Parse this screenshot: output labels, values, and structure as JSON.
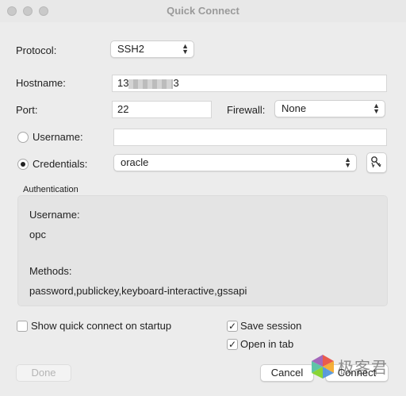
{
  "window": {
    "title": "Quick Connect"
  },
  "form": {
    "protocol_label": "Protocol:",
    "protocol_value": "SSH2",
    "hostname_label": "Hostname:",
    "hostname_prefix": "13",
    "hostname_suffix": "3",
    "port_label": "Port:",
    "port_value": "22",
    "firewall_label": "Firewall:",
    "firewall_value": "None",
    "username_label": "Username:",
    "username_value": "",
    "credentials_label": "Credentials:",
    "credentials_value": "oracle"
  },
  "auth": {
    "section_label": "Authentication",
    "username_label": "Username:",
    "username_value": "opc",
    "methods_label": "Methods:",
    "methods_value": "password,publickey,keyboard-interactive,gssapi"
  },
  "options": {
    "show_on_startup_label": "Show quick connect on startup",
    "show_on_startup_checked": false,
    "save_session_label": "Save session",
    "save_session_checked": true,
    "open_in_tab_label": "Open in tab",
    "open_in_tab_checked": true
  },
  "buttons": {
    "done": "Done",
    "cancel": "Cancel",
    "connect": "Connect"
  },
  "watermark": {
    "text": "极客君"
  },
  "icons": {
    "chevron": "up-down-chevron-icon",
    "key": "key-manager-icon",
    "check": "✓"
  }
}
